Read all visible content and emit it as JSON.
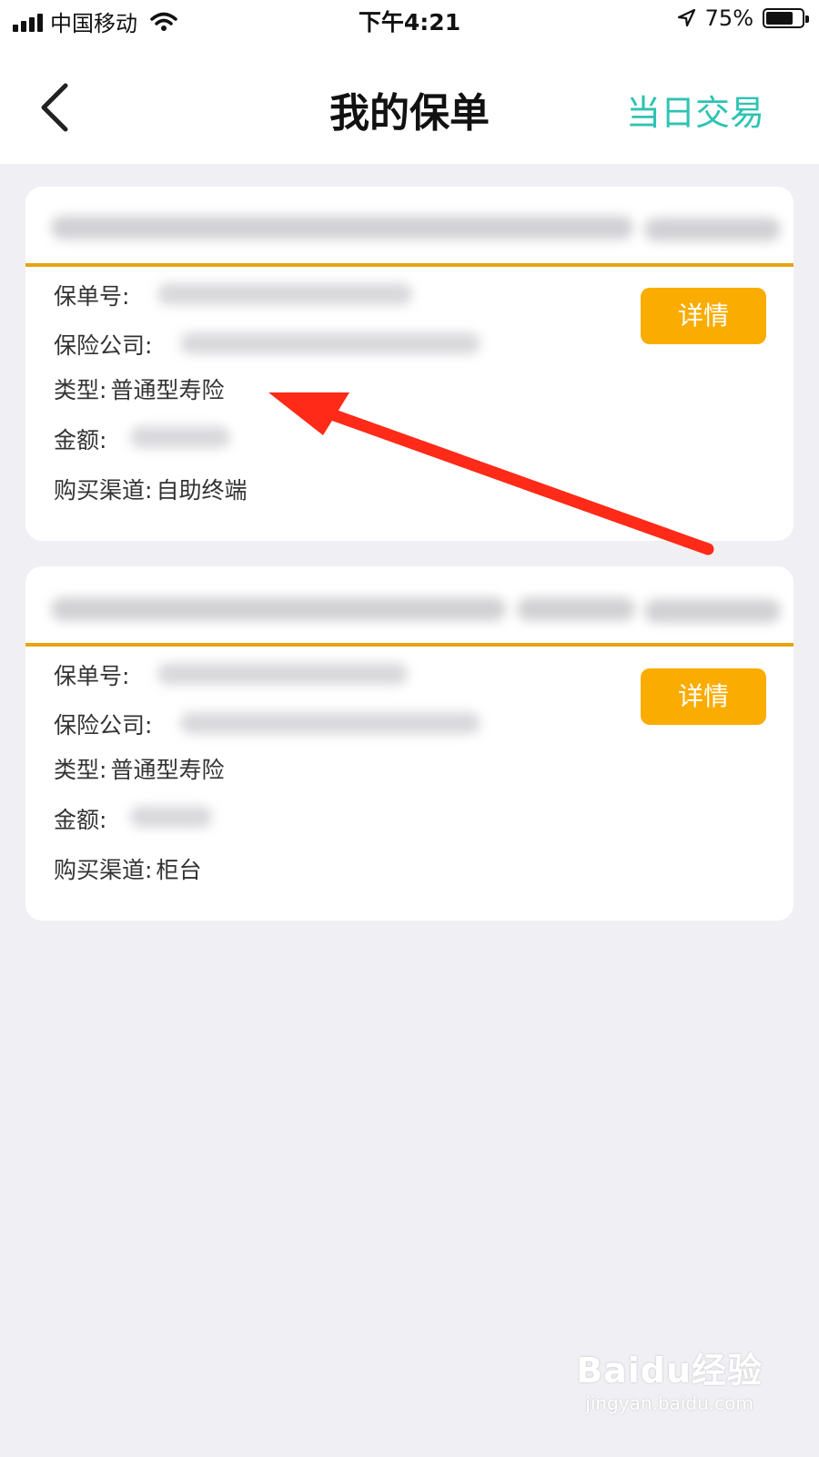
{
  "status_bar": {
    "carrier": "中国移动",
    "time": "下午4:21",
    "battery_pct": "75%",
    "battery_level": 0.75
  },
  "nav": {
    "title": "我的保单",
    "right_link": "当日交易"
  },
  "policies": [
    {
      "policy_no_label": "保单号:",
      "company_label": "保险公司:",
      "type_label": "类型:",
      "type_value": "普通型寿险",
      "amount_label": "金额:",
      "channel_label": "购买渠道:",
      "channel_value": "自助终端",
      "detail_label": "详情"
    },
    {
      "policy_no_label": "保单号:",
      "company_label": "保险公司:",
      "type_label": "类型:",
      "type_value": "普通型寿险",
      "amount_label": "金额:",
      "channel_label": "购买渠道:",
      "channel_value": "柜台",
      "detail_label": "详情"
    }
  ],
  "colors": {
    "accent_teal": "#2ec3b2",
    "button_orange": "#fbac00",
    "rule_gold": "#e5a411",
    "annotation_red": "#ff2a17"
  },
  "watermark": {
    "logo": "Baidu经验",
    "url": "jingyan.baidu.com"
  }
}
